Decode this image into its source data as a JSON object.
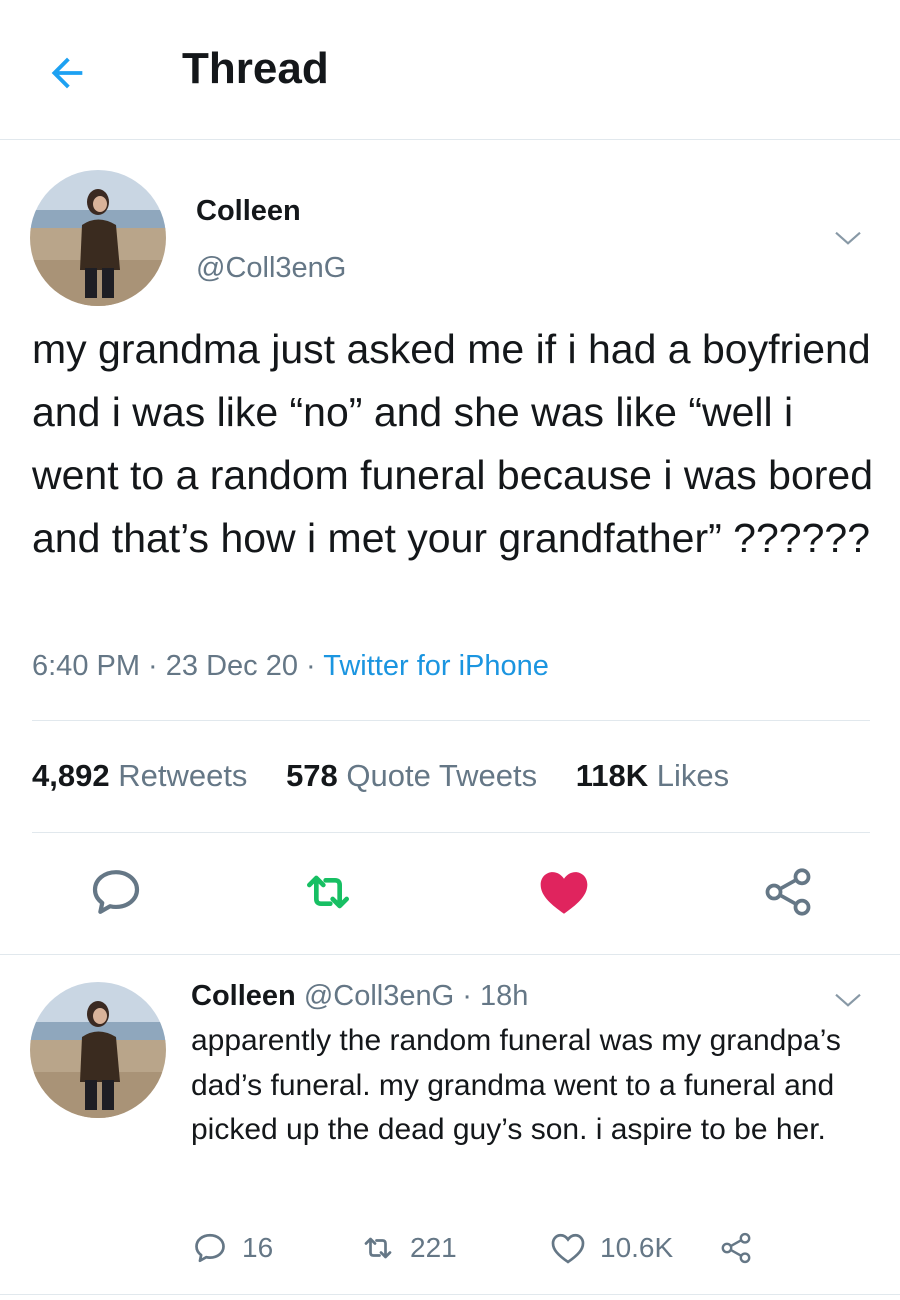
{
  "header": {
    "title": "Thread"
  },
  "tweet": {
    "name": "Colleen",
    "handle": "@Coll3enG",
    "text": "my grandma just asked me if i had a boyfriend and i was like “no” and she was like “well i went to a random funeral because i was bored and that’s how i met your grandfather” ??????",
    "time": "6:40 PM",
    "date": "23 Dec 20",
    "separator": " · ",
    "source": "Twitter for iPhone",
    "stats": {
      "retweets_count": "4,892",
      "retweets_label": "Retweets",
      "quotes_count": "578",
      "quotes_label": "Quote Tweets",
      "likes_count": "118K",
      "likes_label": "Likes"
    },
    "liked": true
  },
  "reply": {
    "name": "Colleen",
    "handle": "@Coll3enG",
    "time": "18h",
    "separator": " · ",
    "text": "apparently the random funeral was my grandpa’s dad’s funeral. my grandma went to a funeral and picked up the dead guy’s son. i aspire to be her.",
    "replies": "16",
    "retweets": "221",
    "likes": "10.6K"
  },
  "colors": {
    "accent": "#1da1f2",
    "retweet": "#17bf63",
    "like": "#e0245e",
    "secondary_text": "#657786",
    "primary_text": "#14171a"
  },
  "icons": [
    "back-arrow-icon",
    "chevron-down-icon",
    "reply-icon",
    "retweet-icon",
    "heart-icon",
    "share-icon"
  ]
}
